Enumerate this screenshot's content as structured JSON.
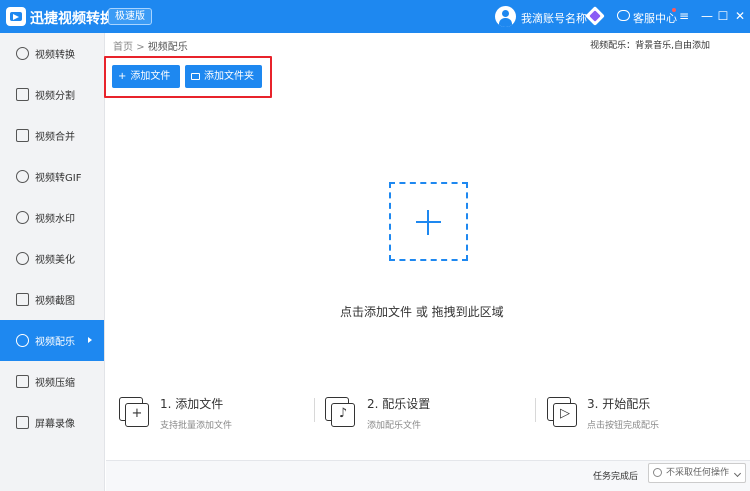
{
  "app": {
    "title": "迅捷视频转换器",
    "badge": "极速版"
  },
  "account": {
    "name": "我滴账号名称",
    "service": "客服中心"
  },
  "window": {
    "menu": "≡",
    "minimize": "—",
    "maximize": "☐",
    "close": "✕"
  },
  "sidebar": {
    "items": [
      {
        "label": "视频转换",
        "icon": "convert-icon"
      },
      {
        "label": "视频分割",
        "icon": "split-icon"
      },
      {
        "label": "视频合并",
        "icon": "merge-icon"
      },
      {
        "label": "视频转GIF",
        "icon": "gif-icon"
      },
      {
        "label": "视频水印",
        "icon": "watermark-icon"
      },
      {
        "label": "视频美化",
        "icon": "beautify-icon"
      },
      {
        "label": "视频截图",
        "icon": "screenshot-icon"
      },
      {
        "label": "视频配乐",
        "icon": "music-icon",
        "active": true
      },
      {
        "label": "视频压缩",
        "icon": "compress-icon"
      },
      {
        "label": "屏幕录像",
        "icon": "record-icon"
      }
    ]
  },
  "breadcrumb": {
    "home": "首页",
    "sep": ">",
    "current": "视频配乐"
  },
  "header_info": "视频配乐：背景音乐,自由添加",
  "toolbar": {
    "add_file": "添加文件",
    "add_folder": "添加文件夹",
    "add_file_glyph": "+"
  },
  "dropzone": {
    "text": "点击添加文件 或 拖拽到此区域"
  },
  "steps": [
    {
      "title": "1. 添加文件",
      "sub": "支持批量添加文件",
      "glyph": "+"
    },
    {
      "title": "2. 配乐设置",
      "sub": "添加配乐文件",
      "glyph": "♪"
    },
    {
      "title": "3. 开始配乐",
      "sub": "点击按钮完成配乐",
      "glyph": "▷"
    }
  ],
  "footer": {
    "label": "任务完成后",
    "select_value": "不采取任何操作"
  },
  "colors": {
    "brand": "#1e88f0",
    "highlight": "#e8232b",
    "sidebar_bg": "#f2f3f5"
  }
}
